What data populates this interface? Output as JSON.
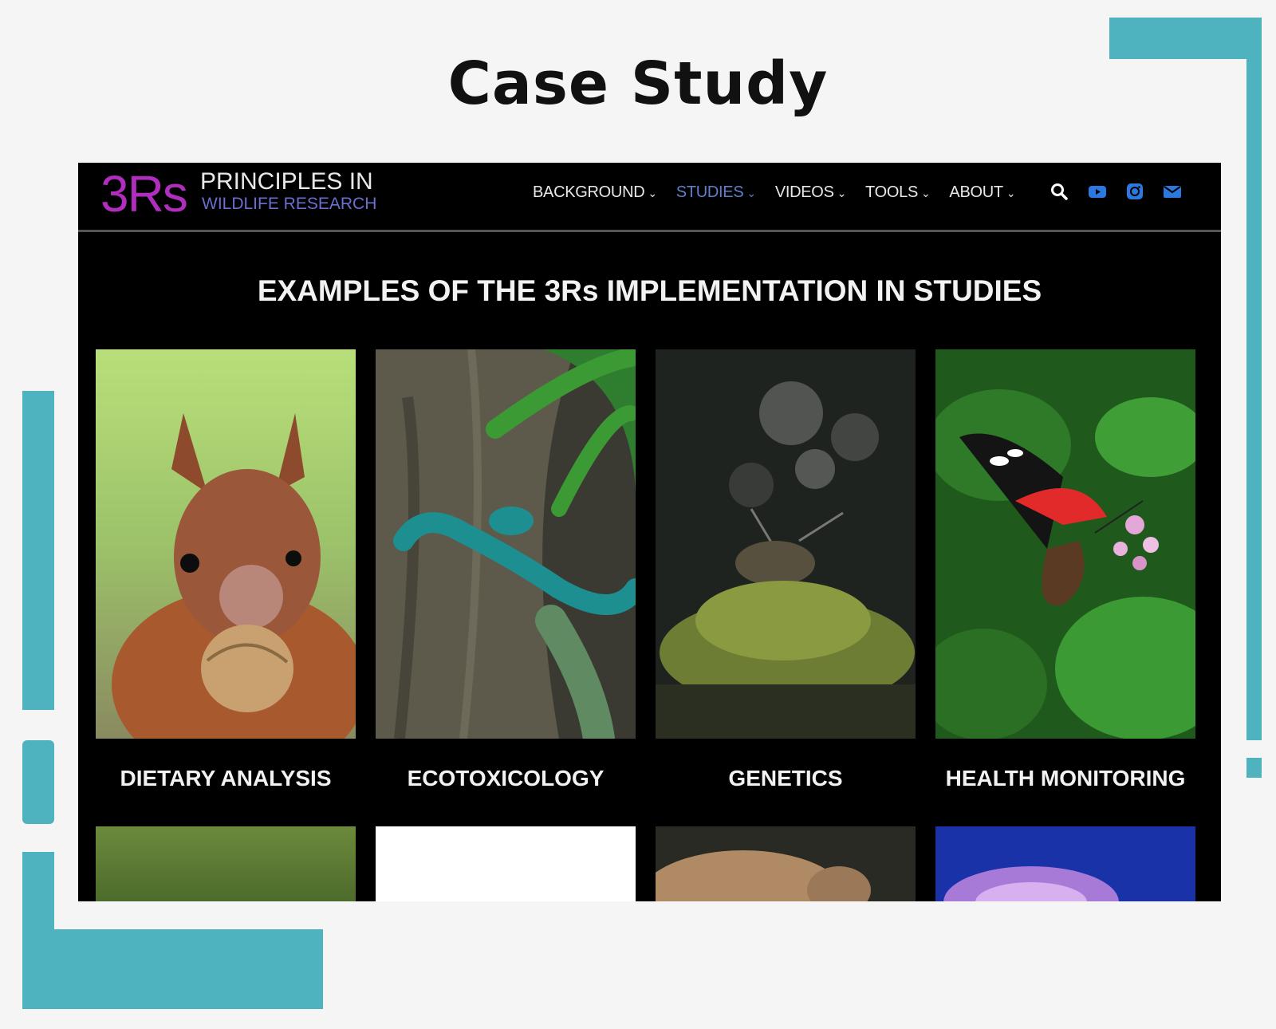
{
  "slide": {
    "title": "Case Study"
  },
  "site": {
    "logo": {
      "mark": "3Rs",
      "line1": "PRINCIPLES IN",
      "line2": "WILDLIFE RESEARCH"
    },
    "nav": [
      {
        "label": "BACKGROUND",
        "active": false
      },
      {
        "label": "STUDIES",
        "active": true
      },
      {
        "label": "VIDEOS",
        "active": false
      },
      {
        "label": "TOOLS",
        "active": false
      },
      {
        "label": "ABOUT",
        "active": false
      }
    ],
    "icons": [
      "search-icon",
      "youtube-icon",
      "instagram-icon",
      "email-icon"
    ],
    "accent_color": "#4fb3bf",
    "brand_color": "#b02dbd",
    "active_nav_color": "#5f7fc8"
  },
  "main": {
    "heading": "EXAMPLES OF THE 3Rs IMPLEMENTATION IN STUDIES",
    "cards": [
      {
        "label": "DIETARY ANALYSIS",
        "image": "red squirrel holding a walnut"
      },
      {
        "label": "ECOTOXICOLOGY",
        "image": "blue pit viper on a tree trunk"
      },
      {
        "label": "GENETICS",
        "image": "snail on green moss"
      },
      {
        "label": "HEALTH MONITORING",
        "image": "red and black butterfly on pink flowers"
      }
    ]
  }
}
